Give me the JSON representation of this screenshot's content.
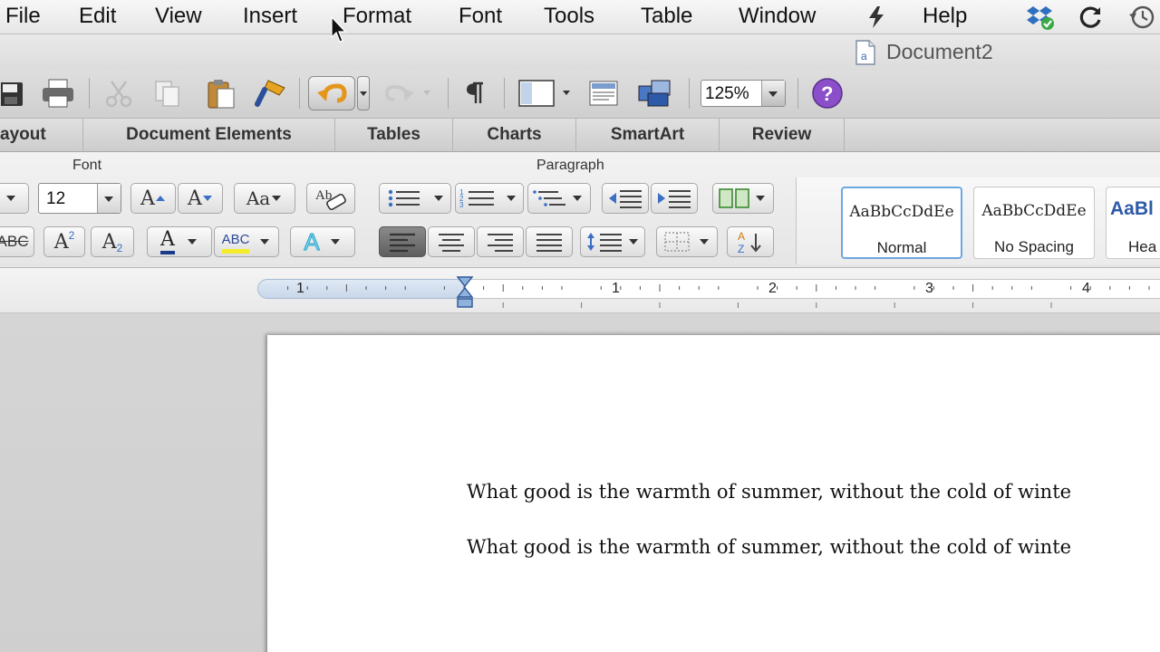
{
  "menubar": {
    "items": [
      "File",
      "Edit",
      "View",
      "Insert",
      "Format",
      "Font",
      "Tools",
      "Table",
      "Window",
      "Help"
    ]
  },
  "window": {
    "title": "Document2"
  },
  "toolbar": {
    "zoom": "125%"
  },
  "ribbon_tabs": [
    "ayout",
    "Document Elements",
    "Tables",
    "Charts",
    "SmartArt",
    "Review"
  ],
  "ribbon": {
    "font_group_label": "Font",
    "paragraph_group_label": "Paragraph",
    "font_size": "12",
    "grow_font_glyph": "A",
    "shrink_font_glyph": "A",
    "change_case_glyph": "Aa",
    "strikethrough_glyph": "ABC",
    "superscript_glyph": "A",
    "superscript_mark": "2",
    "subscript_glyph": "A",
    "subscript_mark": "2",
    "font_color_glyph": "A",
    "highlight_glyph": "ABC",
    "text_effects_glyph": "A",
    "font_color_value": "#1a3a8a",
    "highlight_color_value": "#f2ec2a"
  },
  "styles": [
    {
      "sample": "AaBbCcDdEe",
      "name": "Normal",
      "selected": true
    },
    {
      "sample": "AaBbCcDdEe",
      "name": "No Spacing",
      "selected": false
    },
    {
      "sample": "AaBl",
      "name": "Hea",
      "selected": false
    }
  ],
  "ruler": {
    "marks": [
      "1",
      "1",
      "2",
      "3",
      "4"
    ]
  },
  "document": {
    "lines": [
      "What good is the warmth of summer, without the cold of winte",
      "What good is the warmth of summer, without the cold of winte"
    ]
  },
  "colors": {
    "accent_blue": "#6ea7e0",
    "help_purple": "#8a4fc9"
  }
}
